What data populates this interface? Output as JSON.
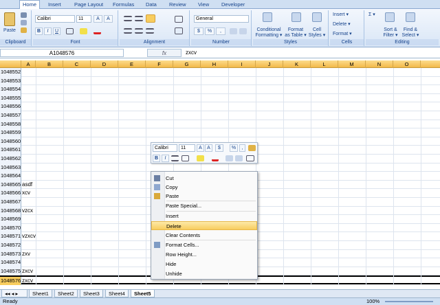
{
  "ribbon": {
    "tabs": [
      "Home",
      "Insert",
      "Page Layout",
      "Formulas",
      "Data",
      "Review",
      "View",
      "Developer"
    ],
    "groups": {
      "clipboard": "Clipboard",
      "font": "Font",
      "alignment": "Alignment",
      "number": "Number",
      "styles": "Styles",
      "cells": "Cells",
      "editing": "Editing"
    },
    "paste": "Paste",
    "font_name": "Calibri",
    "font_size": "11",
    "bold": "B",
    "italic": "I",
    "underline": "U",
    "number_format": "General",
    "currency": "$",
    "percent": "%",
    "comma": ",",
    "cond_format": "Conditional",
    "cond_format2": "Formatting ▾",
    "format_table": "Format",
    "format_table2": "as Table ▾",
    "cell_styles": "Cell",
    "cell_styles2": "Styles ▾",
    "insert": "Insert ▾",
    "delete": "Delete ▾",
    "format": "Format ▾",
    "sigma": "Σ ▾",
    "sort": "Sort &",
    "sort2": "Filter ▾",
    "find": "Find &",
    "find2": "Select ▾"
  },
  "formula_bar": {
    "name_box": "A1048576",
    "fx": "fx",
    "value": "zxcv"
  },
  "columns": [
    "A",
    "B",
    "C",
    "D",
    "E",
    "F",
    "G",
    "H",
    "I",
    "J",
    "K",
    "L",
    "M",
    "N",
    "O"
  ],
  "rows": [
    {
      "n": "1048552",
      "a": ""
    },
    {
      "n": "1048553",
      "a": ""
    },
    {
      "n": "1048554",
      "a": ""
    },
    {
      "n": "1048555",
      "a": ""
    },
    {
      "n": "1048556",
      "a": ""
    },
    {
      "n": "1048557",
      "a": ""
    },
    {
      "n": "1048558",
      "a": ""
    },
    {
      "n": "1048559",
      "a": ""
    },
    {
      "n": "1048560",
      "a": ""
    },
    {
      "n": "1048561",
      "a": ""
    },
    {
      "n": "1048562",
      "a": ""
    },
    {
      "n": "1048563",
      "a": ""
    },
    {
      "n": "1048564",
      "a": ""
    },
    {
      "n": "1048565",
      "a": "asdf"
    },
    {
      "n": "1048566",
      "a": "xcv"
    },
    {
      "n": "1048567",
      "a": ""
    },
    {
      "n": "1048568",
      "a": "vzcx"
    },
    {
      "n": "1048569",
      "a": ""
    },
    {
      "n": "1048570",
      "a": ""
    },
    {
      "n": "1048571",
      "a": "vzxcv"
    },
    {
      "n": "1048572",
      "a": ""
    },
    {
      "n": "1048573",
      "a": "zxv"
    },
    {
      "n": "1048574",
      "a": ""
    },
    {
      "n": "1048575",
      "a": "zxcv"
    },
    {
      "n": "1048576",
      "a": "zxcv"
    }
  ],
  "mini_toolbar": {
    "font": "Calibri",
    "size": "11",
    "b": "B",
    "i": "I",
    "dollar": "$",
    "pct": "%",
    "comma": ","
  },
  "context_menu": [
    "Cut",
    "Copy",
    "Paste",
    "Paste Special...",
    "Insert",
    "Delete",
    "Clear Contents",
    "Format Cells...",
    "Row Height...",
    "Hide",
    "Unhide"
  ],
  "sheets": [
    "Sheet1",
    "Sheet2",
    "Sheet3",
    "Sheet4",
    "Sheet5"
  ],
  "status": {
    "ready": "Ready",
    "zoom": "100%"
  },
  "colors": {
    "accent": "#15428b",
    "highlight": "#f8cd5e"
  }
}
